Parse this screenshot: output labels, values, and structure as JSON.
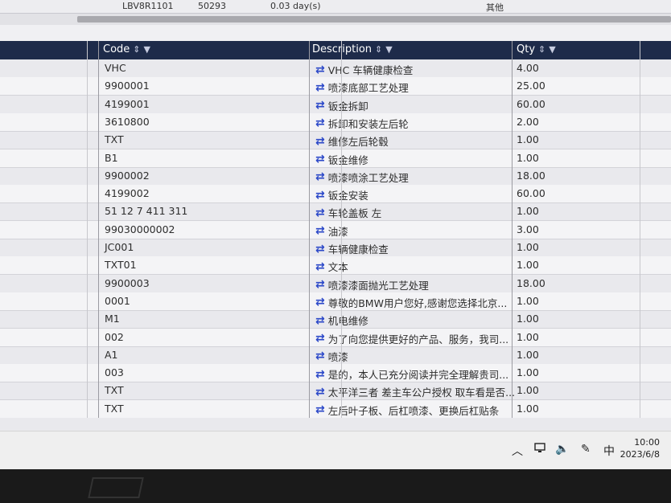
{
  "top_strip": {
    "code": "LBV8R1101",
    "num": "50293",
    "days": "0.03 day(s)",
    "other": "其他"
  },
  "table": {
    "headers": {
      "code": "Code",
      "description": "Description",
      "qty": "Qty"
    },
    "sort_icon": "sort-icon",
    "filter_icon": "filter-icon",
    "rows": [
      {
        "code": "VHC",
        "description": "VHC 车辆健康检查",
        "qty": "4.00"
      },
      {
        "code": "9900001",
        "description": "喷漆底部工艺处理",
        "qty": "25.00"
      },
      {
        "code": "4199001",
        "description": "钣金拆卸",
        "qty": "60.00"
      },
      {
        "code": "3610800",
        "description": "拆卸和安装左后轮",
        "qty": "2.00"
      },
      {
        "code": "TXT",
        "description": "维修左后轮毂",
        "qty": "1.00"
      },
      {
        "code": "B1",
        "description": "钣金维修",
        "qty": "1.00"
      },
      {
        "code": "9900002",
        "description": "喷漆喷涂工艺处理",
        "qty": "18.00"
      },
      {
        "code": "4199002",
        "description": "钣金安装",
        "qty": "60.00"
      },
      {
        "code": "51 12 7 411 311",
        "description": "车轮盖板 左",
        "qty": "1.00"
      },
      {
        "code": "99030000002",
        "description": "油漆",
        "qty": "3.00"
      },
      {
        "code": "JC001",
        "description": "车辆健康检查",
        "qty": "1.00"
      },
      {
        "code": "TXT01",
        "description": "文本",
        "qty": "1.00"
      },
      {
        "code": "9900003",
        "description": "喷漆漆面抛光工艺处理",
        "qty": "18.00"
      },
      {
        "code": "0001",
        "description": "尊敬的BMW用户您好,感谢您选择北京...",
        "qty": "1.00"
      },
      {
        "code": "M1",
        "description": "机电维修",
        "qty": "1.00"
      },
      {
        "code": "002",
        "description": "为了向您提供更好的产品、服务，我司...",
        "qty": "1.00"
      },
      {
        "code": "A1",
        "description": "喷漆",
        "qty": "1.00"
      },
      {
        "code": "003",
        "description": "是的，本人已充分阅读并完全理解贵司...",
        "qty": "1.00"
      },
      {
        "code": "TXT",
        "description": "太平洋三者 差主车公户授权 取车看是否...",
        "qty": "1.00"
      },
      {
        "code": "TXT",
        "description": "左后叶子板、后杠喷漆、更换后杠贴条",
        "qty": "1.00"
      }
    ]
  },
  "taskbar": {
    "ime": "中",
    "time": "10:00",
    "date": "2023/6/8"
  },
  "colors": {
    "header_bg": "#1e2b4a",
    "swap_icon": "#2a47c8"
  }
}
